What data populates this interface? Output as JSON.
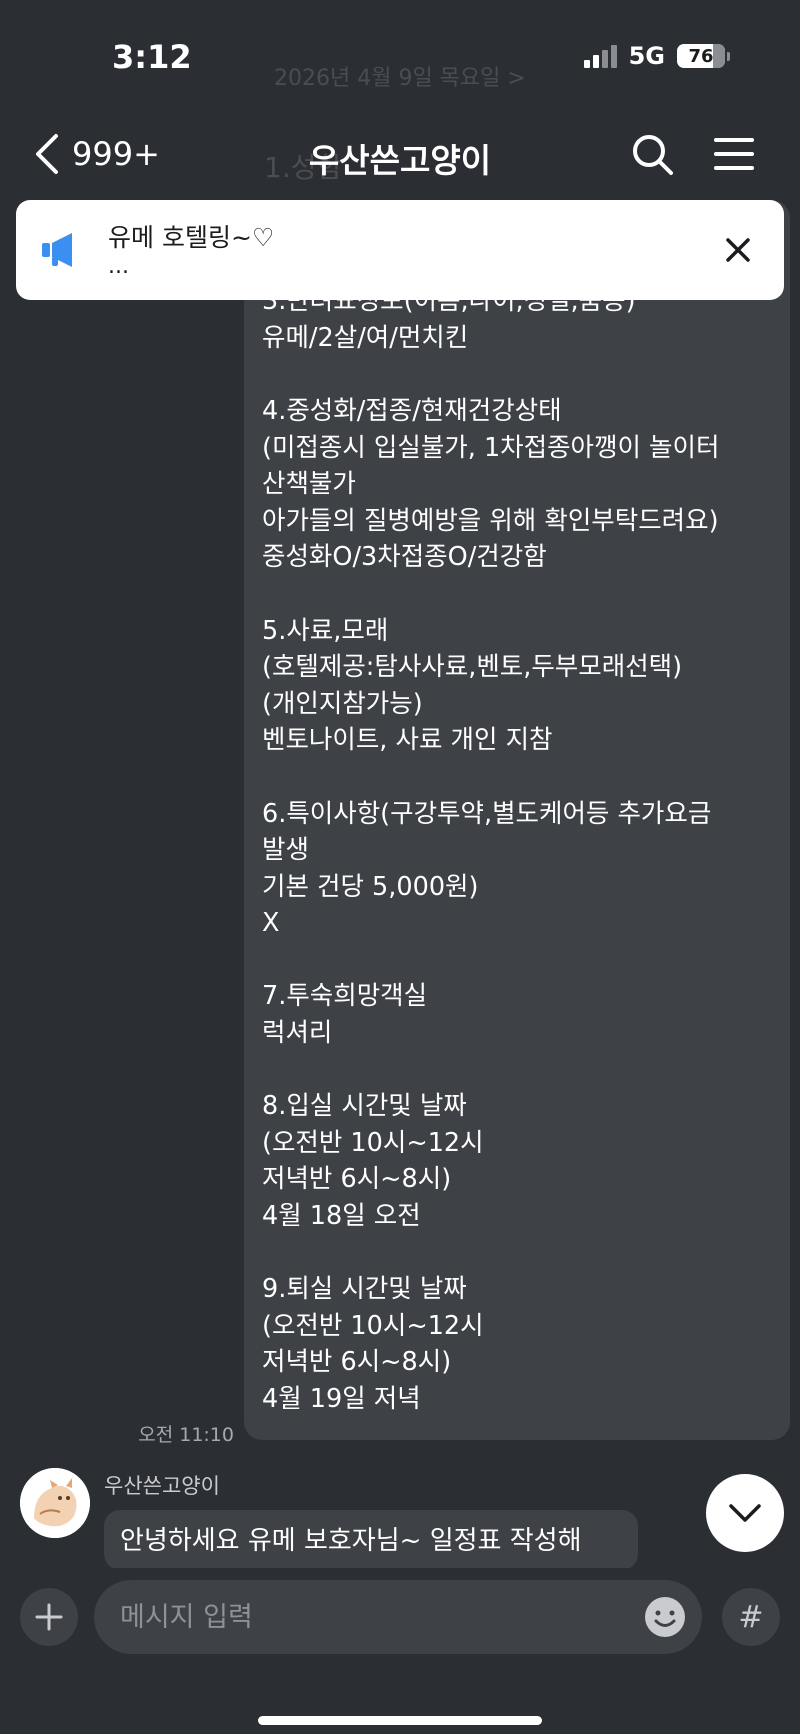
{
  "status": {
    "time": "3:12",
    "network": "5G",
    "battery": "76"
  },
  "date_ghost": "2026년 4월 9일 목요일 >",
  "header": {
    "back_count": "999+",
    "title": "우산쓴고양이",
    "title_ghost": "1.성함"
  },
  "notice": {
    "title": "유메 호텔링~♡",
    "sub": "..."
  },
  "message": {
    "lines": [
      "",
      "",
      "3.반려묘정보(이름,나이,성별,품종)",
      "유메/2살/여/먼치킨",
      "",
      "4.중성화/접종/현재건강상태",
      "(미접종시 입실불가, 1차접종아깽이 놀이터",
      "산책불가",
      "아가들의 질병예방을 위해 확인부탁드려요)",
      "중성화O/3차접종O/건강함",
      "",
      "5.사료,모래",
      "(호텔제공:탐사사료,벤토,두부모래선택)",
      "(개인지참가능)",
      "벤토나이트, 사료 개인 지참",
      "",
      "6.특이사항(구강투약,별도케어등 추가요금",
      "발생",
      "기본 건당 5,000원)",
      "X",
      "",
      "7.투숙희망객실",
      "럭셔리",
      "",
      "8.입실 시간및 날짜",
      "(오전반 10시~12시",
      "저녁반 6시~8시)",
      "4월 18일 오전",
      "",
      "9.퇴실 시간및 날짜",
      "(오전반 10시~12시",
      "저녁반 6시~8시)",
      "4월 19일 저녁"
    ],
    "time": "오전 11:10"
  },
  "incoming": {
    "sender": "우산쓴고양이",
    "text": "안녕하세요 유메 보호자님~ 일정표 작성해"
  },
  "input": {
    "placeholder": "메시지 입력",
    "hash": "#"
  },
  "colors": {
    "background": "#2b2e33",
    "bubble": "#3e4146",
    "notice_icon": "#3a8ff0"
  }
}
